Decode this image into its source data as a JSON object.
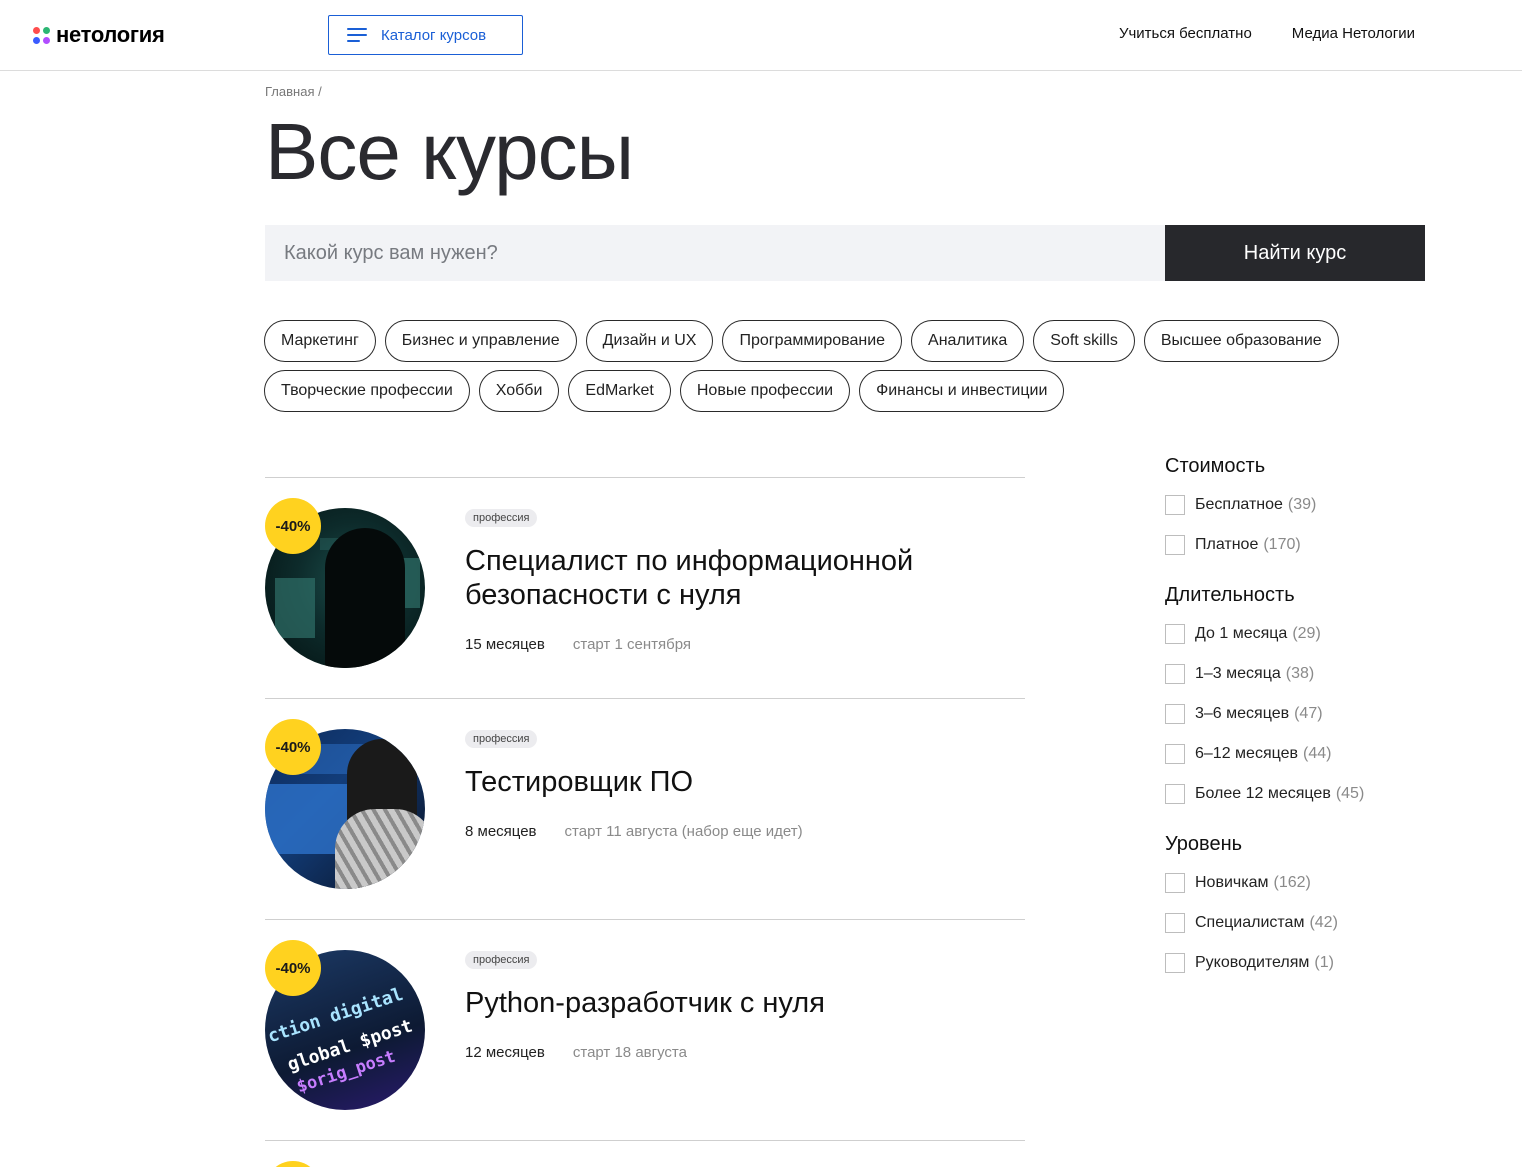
{
  "header": {
    "logo_text": "нетология",
    "catalog_label": "Каталог курсов",
    "nav": [
      "Учиться бесплатно",
      "Медиа Нетологии"
    ]
  },
  "breadcrumb": "Главная /",
  "page_title": "Все курсы",
  "search": {
    "placeholder": "Какой курс вам нужен?",
    "button_label": "Найти курс"
  },
  "categories": [
    "Маркетинг",
    "Бизнес и управление",
    "Дизайн и UX",
    "Программирование",
    "Аналитика",
    "Soft skills",
    "Высшее образование",
    "Творческие профессии",
    "Хобби",
    "EdMarket",
    "Новые профессии",
    "Финансы и инвестиции"
  ],
  "courses": [
    {
      "discount": "-40%",
      "tag": "профессия",
      "title": "Специалист по информационной безопасности с нуля",
      "duration": "15 месяцев",
      "start": "старт 1 сентября"
    },
    {
      "discount": "-40%",
      "tag": "профессия",
      "title": "Тестировщик ПО",
      "duration": "8 месяцев",
      "start": "старт 11 августа (набор еще идет)"
    },
    {
      "discount": "-40%",
      "tag": "профессия",
      "title": "Python-разработчик с нуля",
      "duration": "12 месяцев",
      "start": "старт 18 августа"
    }
  ],
  "course_art_text": [
    "ction digital",
    "global $post",
    "$orig_post"
  ],
  "filters": [
    {
      "title": "Стоимость",
      "options": [
        {
          "label": "Бесплатное",
          "count": "(39)"
        },
        {
          "label": "Платное",
          "count": "(170)"
        }
      ]
    },
    {
      "title": "Длительность",
      "options": [
        {
          "label": "До 1 месяца",
          "count": "(29)"
        },
        {
          "label": "1–3 месяца",
          "count": "(38)"
        },
        {
          "label": "3–6 месяцев",
          "count": "(47)"
        },
        {
          "label": "6–12 месяцев",
          "count": "(44)"
        },
        {
          "label": "Более 12 месяцев",
          "count": "(45)"
        }
      ]
    },
    {
      "title": "Уровень",
      "options": [
        {
          "label": "Новичкам",
          "count": "(162)"
        },
        {
          "label": "Специалистам",
          "count": "(42)"
        },
        {
          "label": "Руководителям",
          "count": "(1)"
        }
      ]
    }
  ],
  "colors": {
    "accent_blue": "#1a5fd6",
    "discount_yellow": "#ffd21f",
    "dark_button": "#27282c"
  }
}
